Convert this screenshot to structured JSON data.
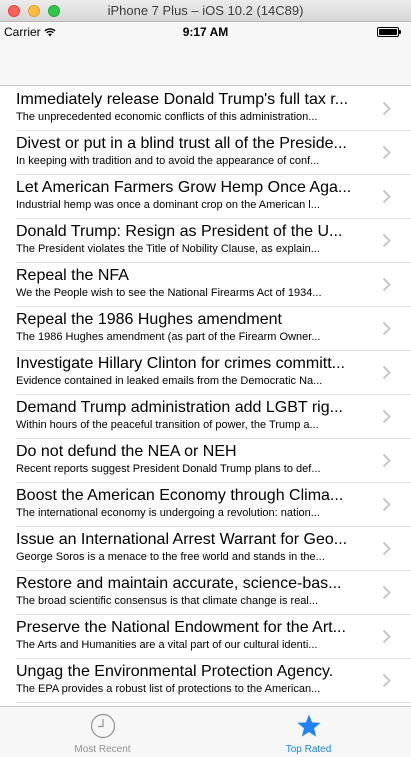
{
  "window": {
    "title": "iPhone 7 Plus – iOS 10.2 (14C89)"
  },
  "status_bar": {
    "carrier": "Carrier",
    "time": "9:17 AM",
    "wifi_icon": "wifi-icon",
    "battery_level": 1.0
  },
  "petitions": [
    {
      "title": "Immediately release Donald Trump's full tax r...",
      "subtitle": "The unprecedented economic conflicts of this administration..."
    },
    {
      "title": "Divest or put in a blind trust all of the Preside...",
      "subtitle": "In keeping with tradition and to avoid the appearance of conf..."
    },
    {
      "title": "Let American Farmers Grow Hemp Once Aga...",
      "subtitle": "Industrial hemp was once a dominant crop on the American l..."
    },
    {
      "title": "Donald Trump:  Resign as President of the U...",
      "subtitle": "The President violates the Title of Nobility Clause, as explain..."
    },
    {
      "title": "Repeal the NFA",
      "subtitle": "We the People wish to see the National Firearms Act of 1934..."
    },
    {
      "title": "Repeal the 1986 Hughes amendment",
      "subtitle": "The 1986 Hughes amendment (as part of the Firearm Owner..."
    },
    {
      "title": "Investigate Hillary Clinton for crimes committ...",
      "subtitle": "Evidence contained in leaked emails from the Democratic Na..."
    },
    {
      "title": "Demand Trump administration add LGBT rig...",
      "subtitle": "Within hours of the peaceful transition of power, the Trump a..."
    },
    {
      "title": "Do not defund the NEA or NEH",
      "subtitle": "Recent reports suggest President Donald Trump plans to def..."
    },
    {
      "title": "Boost the American Economy through Clima...",
      "subtitle": "The international economy is undergoing a revolution: nation..."
    },
    {
      "title": "Issue an International Arrest Warrant for Geo...",
      "subtitle": "George Soros is a menace to the free world and stands in the..."
    },
    {
      "title": "Restore and maintain accurate, science-bas...",
      "subtitle": "The broad scientific consensus is that climate change is real..."
    },
    {
      "title": "Preserve the National Endowment for the Art...",
      "subtitle": "The Arts and Humanities  are a vital part of our cultural identi..."
    },
    {
      "title": "Ungag the Environmental Protection Agency.",
      "subtitle": "The EPA provides a robust list of protections to the American..."
    }
  ],
  "tab_bar": {
    "tabs": [
      {
        "label": "Most Recent",
        "icon": "clock-icon",
        "selected": false
      },
      {
        "label": "Top Rated",
        "icon": "star-icon",
        "selected": true
      }
    ]
  },
  "colors": {
    "accent": "#1f83f5",
    "inactive": "#929292"
  }
}
